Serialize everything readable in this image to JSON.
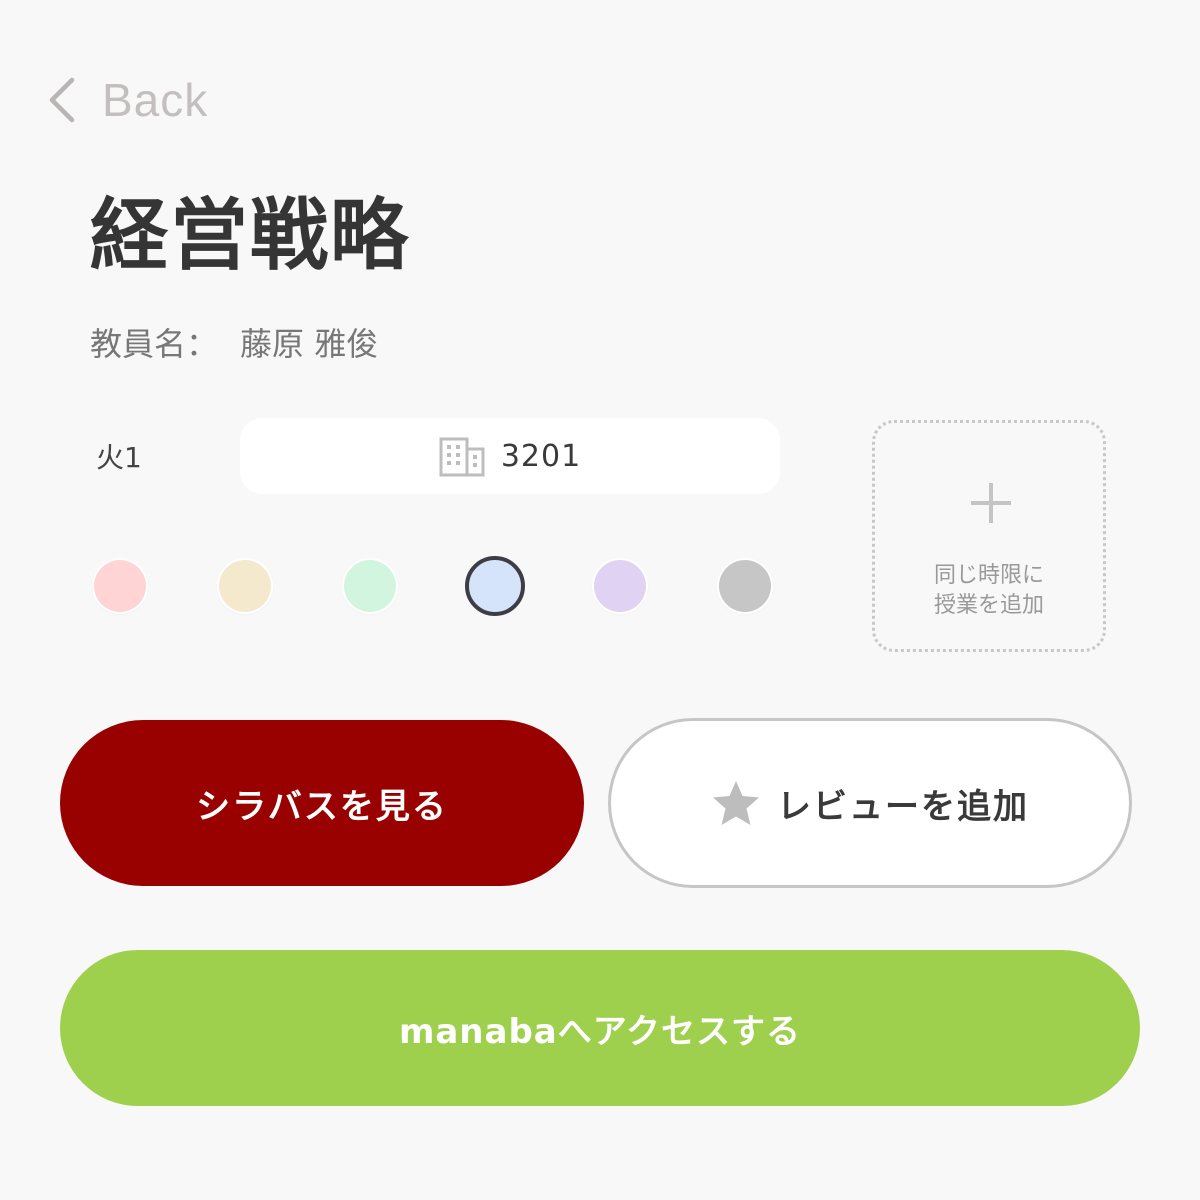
{
  "nav": {
    "back_label": "Back"
  },
  "course": {
    "title": "経営戦略",
    "teacher_label": "教員名：",
    "teacher_name": "藤原 雅俊",
    "period": "火1",
    "room": "3201"
  },
  "colors": {
    "options": [
      "#ffd4d4",
      "#f4e9cd",
      "#d1f5df",
      "#d6e4fb",
      "#e0d2f3",
      "#c6c6c6"
    ],
    "selected_index": 3
  },
  "add_slot": {
    "line1": "同じ時限に",
    "line2": "授業を追加"
  },
  "buttons": {
    "syllabus": "シラバスを見る",
    "review": "レビューを追加",
    "manaba": "manabaへアクセスする"
  },
  "theme": {
    "primary": "#990000",
    "manaba": "#9fd04d"
  }
}
